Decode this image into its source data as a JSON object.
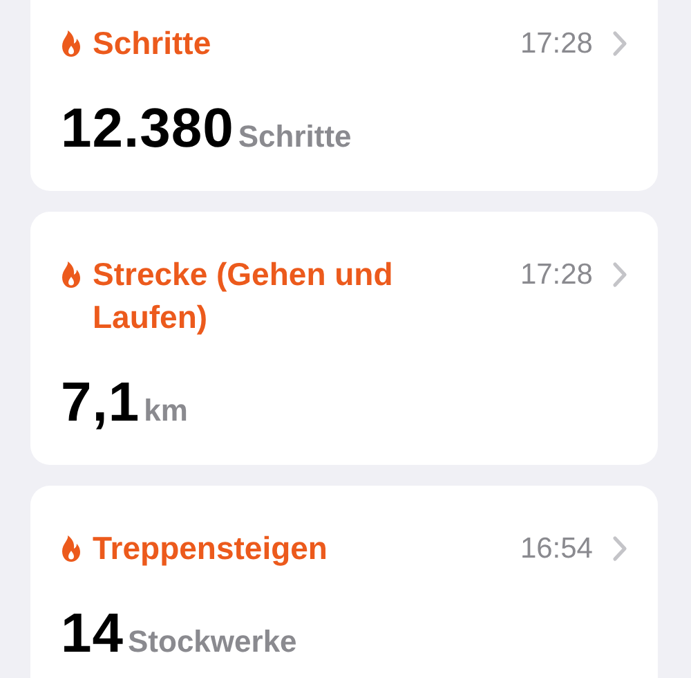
{
  "cards": [
    {
      "title": "Schritte",
      "time": "17:28",
      "value": "12.380",
      "unit": "Schritte"
    },
    {
      "title": "Strecke (Gehen und Laufen)",
      "time": "17:28",
      "value": "7,1",
      "unit": "km"
    },
    {
      "title": "Treppensteigen",
      "time": "16:54",
      "value": "14",
      "unit": "Stockwerke"
    }
  ]
}
